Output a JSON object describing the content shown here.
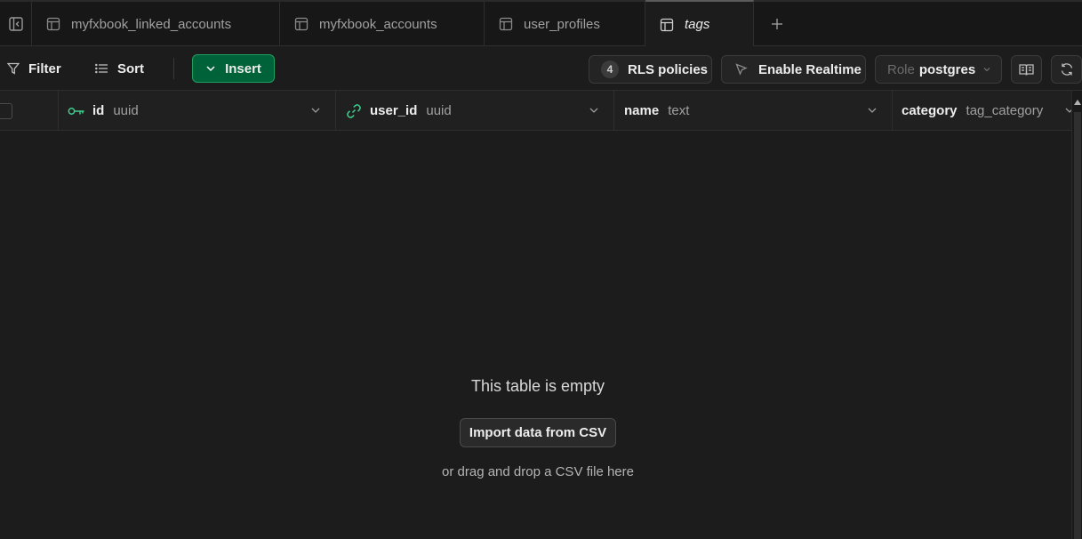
{
  "tabs": [
    {
      "label": "myfxbook_linked_accounts",
      "active": false
    },
    {
      "label": "myfxbook_accounts",
      "active": false
    },
    {
      "label": "user_profiles",
      "active": false
    },
    {
      "label": "tags",
      "active": true
    }
  ],
  "toolbar": {
    "filter_label": "Filter",
    "sort_label": "Sort",
    "insert_label": "Insert",
    "rls_count": "4",
    "rls_label": "RLS policies",
    "realtime_label": "Enable Realtime",
    "role_prefix": "Role",
    "role_value": "postgres"
  },
  "columns": [
    {
      "name": "id",
      "type": "uuid",
      "icon": "key-icon"
    },
    {
      "name": "user_id",
      "type": "uuid",
      "icon": "link-icon"
    },
    {
      "name": "name",
      "type": "text",
      "icon": ""
    },
    {
      "name": "category",
      "type": "tag_category",
      "icon": ""
    }
  ],
  "empty_state": {
    "title": "This table is empty",
    "import_label": "Import data from CSV",
    "hint": "or drag and drop a CSV file here"
  },
  "colors": {
    "accent_green": "#006239",
    "key_icon": "#3ecf8e",
    "background": "#1c1c1c"
  }
}
